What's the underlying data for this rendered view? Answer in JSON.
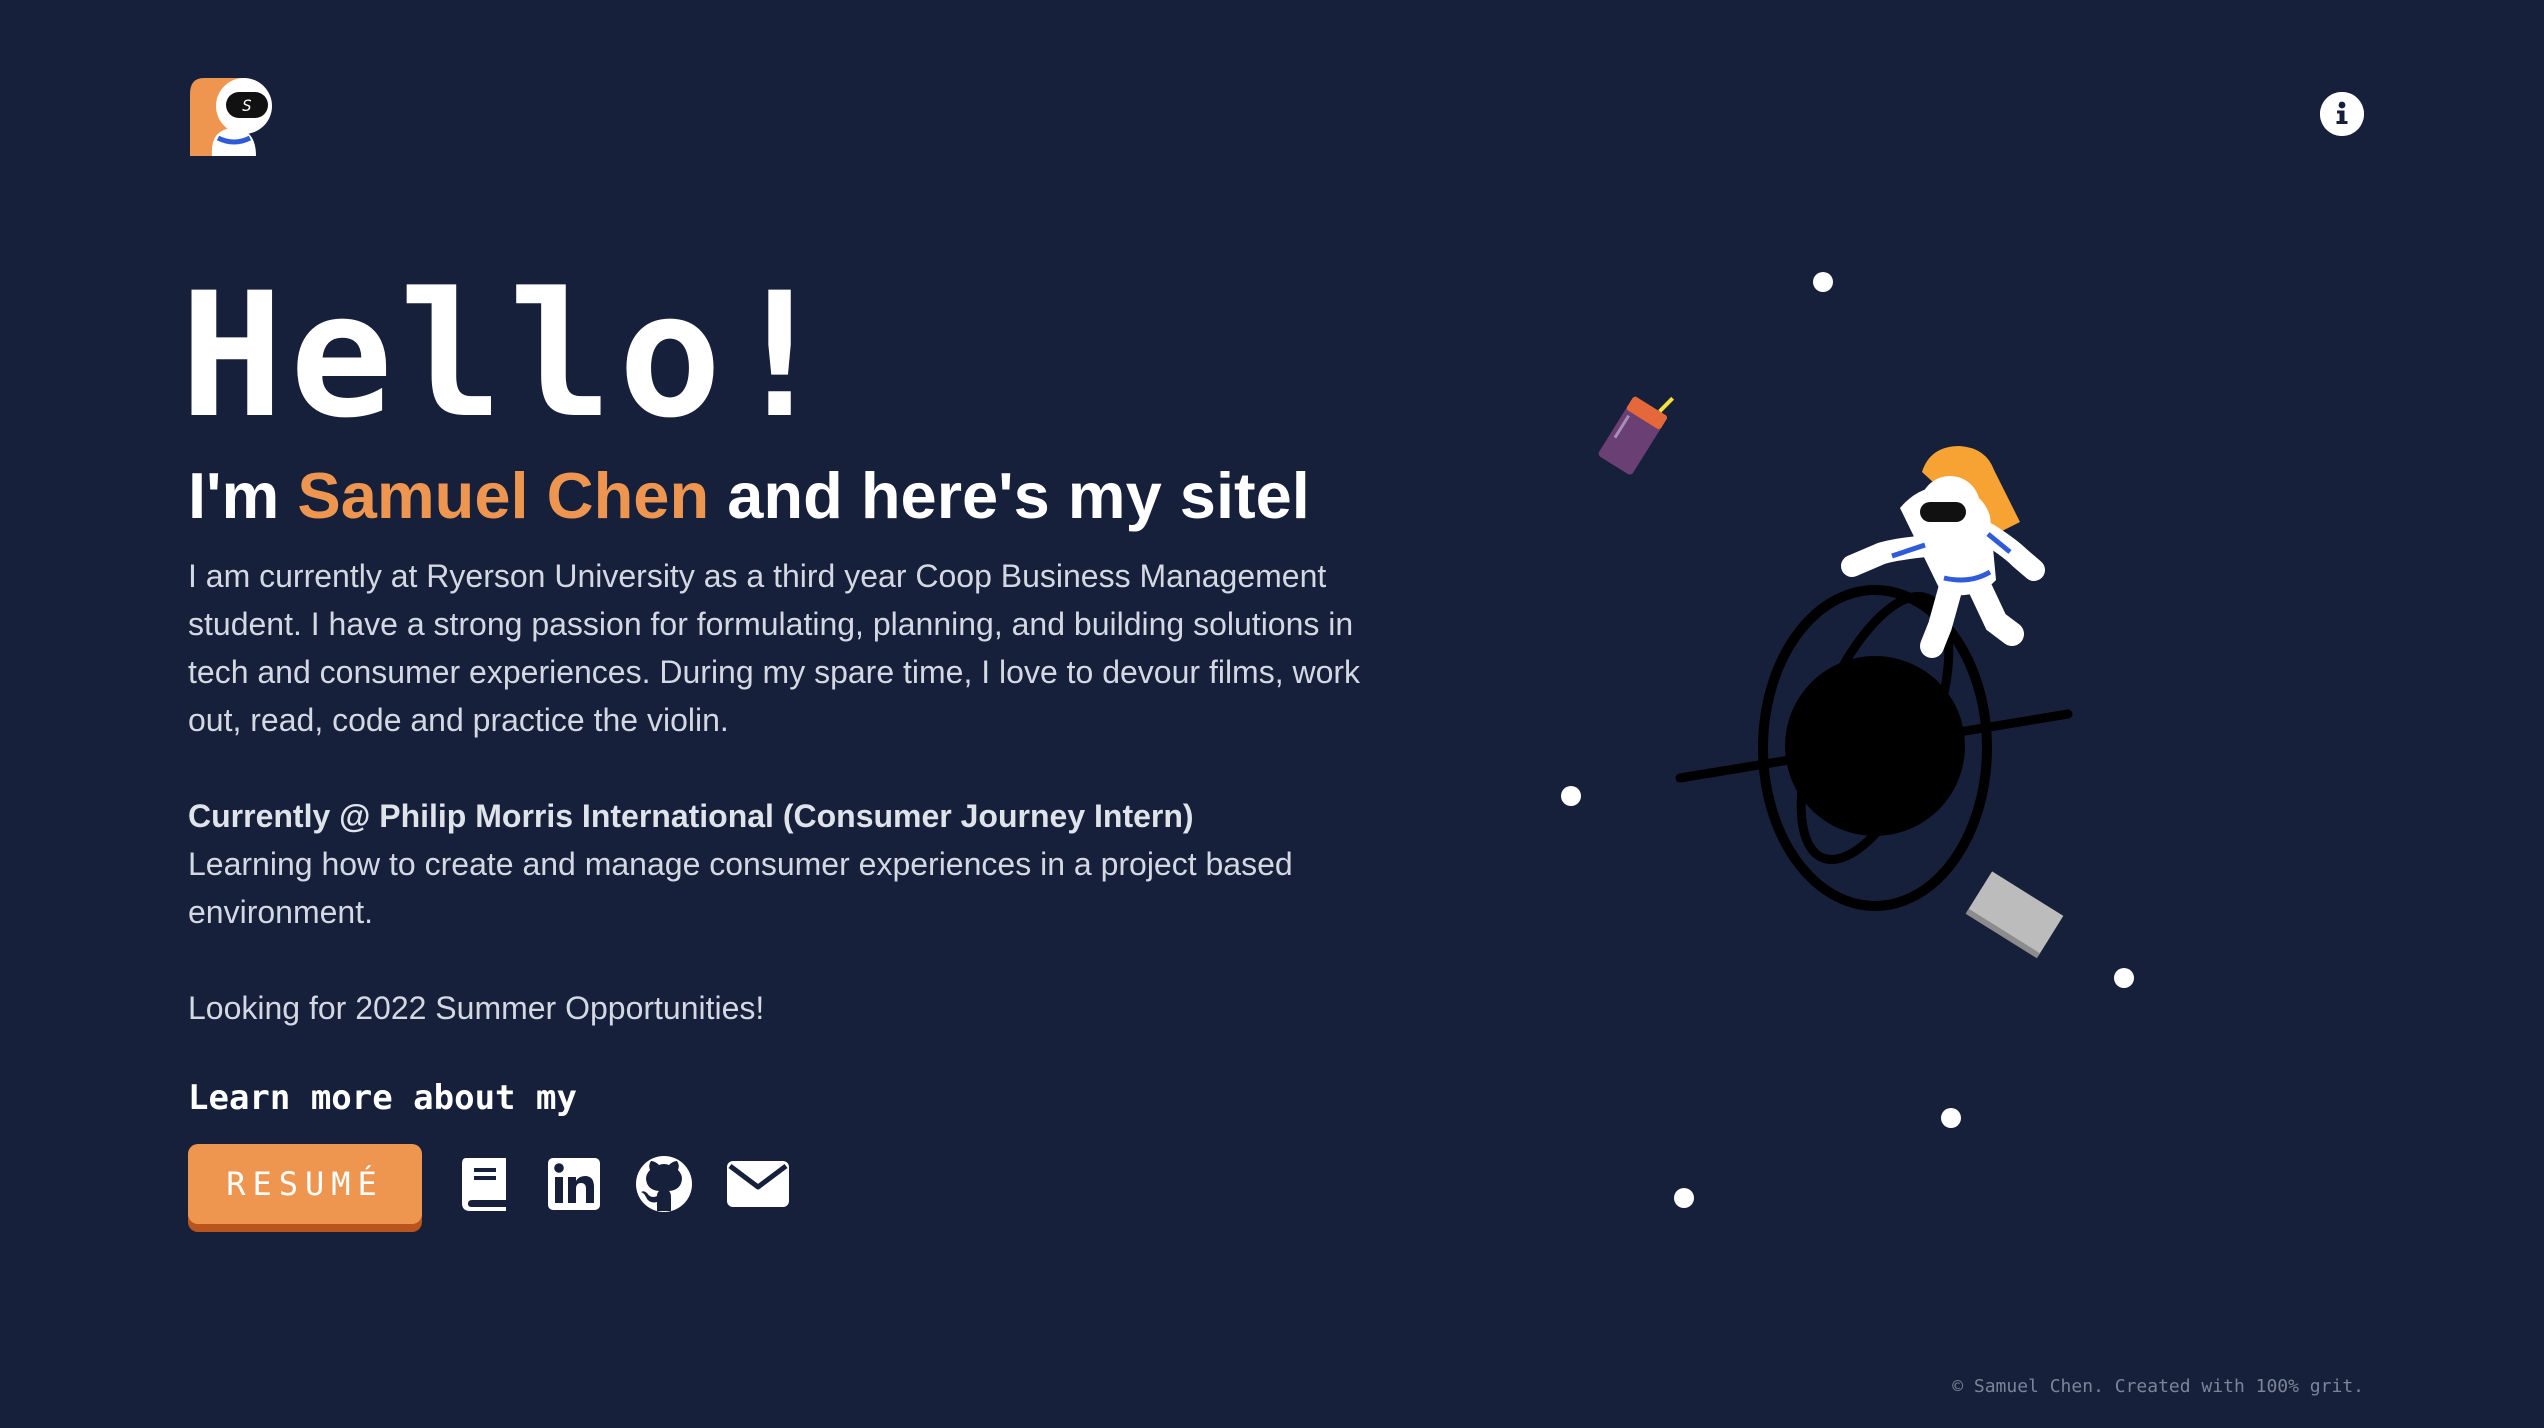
{
  "header": {
    "logo_icon": "astronaut-avatar-icon",
    "info_icon": "info-icon",
    "logo_letter": "S"
  },
  "hero": {
    "greeting": "Hello!",
    "intro_prefix": "I'm ",
    "name": "Samuel Chen",
    "intro_suffix": " and here's my sitel",
    "bio": "I am currently at Ryerson University as a third year Coop Business Management student. I have a strong passion for formulating, planning, and building solutions in tech and consumer experiences. During my spare time, I love to devour films, work out, read, code and practice the violin.",
    "current_title": "Currently @ Philip Morris International (Consumer Journey Intern)",
    "current_description": "Learning how to create and manage consumer experiences in a project based environment.",
    "looking": "Looking for 2022 Summer Opportunities!",
    "learn_more": "Learn more about my"
  },
  "actions": {
    "resume_label": "RESUMÉ",
    "links": [
      {
        "icon": "book-icon"
      },
      {
        "icon": "linkedin-icon"
      },
      {
        "icon": "github-icon"
      },
      {
        "icon": "mail-icon"
      }
    ]
  },
  "footer": {
    "text": "© Samuel Chen. Created with 100% grit."
  },
  "theme": {
    "background": "#16203b",
    "accent": "#ee9650",
    "accent_shadow": "#b8541c",
    "text": "#ffffff"
  }
}
